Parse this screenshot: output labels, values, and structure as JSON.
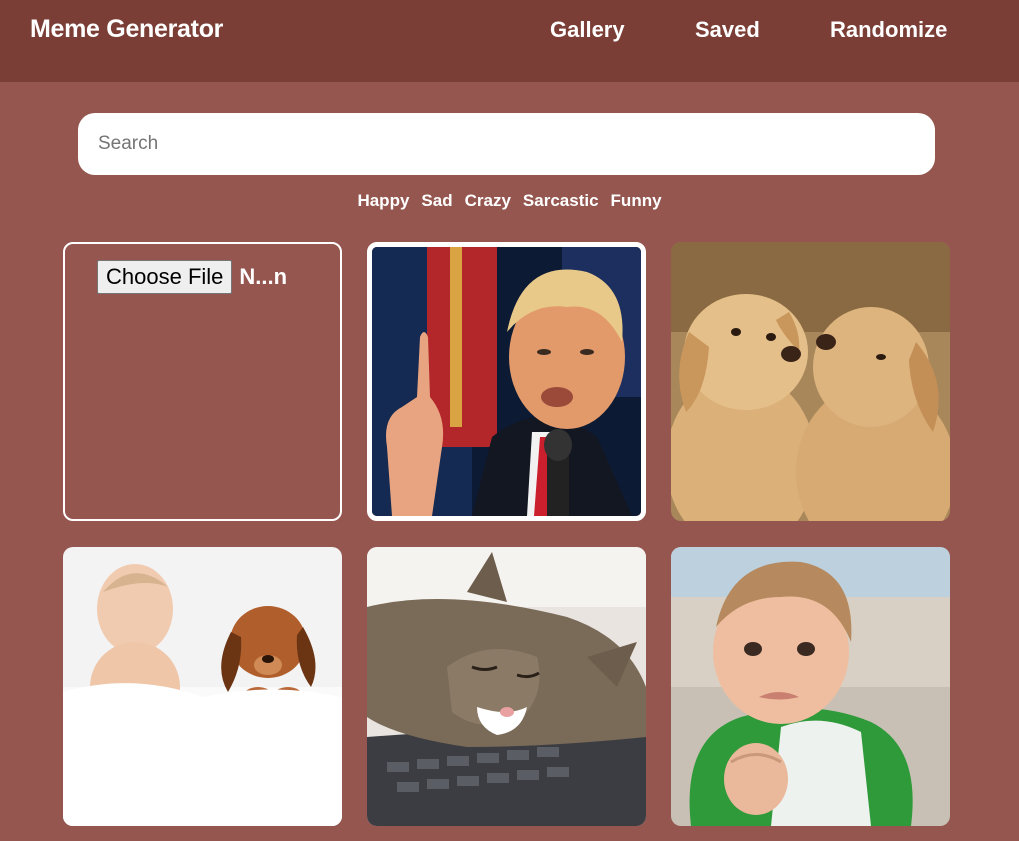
{
  "header": {
    "brand": "Meme Generator",
    "nav": [
      {
        "label": "Gallery"
      },
      {
        "label": "Saved"
      },
      {
        "label": "Randomize"
      }
    ]
  },
  "search": {
    "placeholder": "Search",
    "value": ""
  },
  "tags": [
    "Happy",
    "Sad",
    "Crazy",
    "Sarcastic",
    "Funny"
  ],
  "upload": {
    "button_label": "Choose File",
    "file_name": "N...n"
  },
  "gallery": [
    {
      "name": "trump-pointing-meme",
      "selected": true
    },
    {
      "name": "two-puppies-meme",
      "selected": false
    },
    {
      "name": "baby-and-puppy-sleeping-meme",
      "selected": false
    },
    {
      "name": "cat-sleeping-on-laptop-meme",
      "selected": false
    },
    {
      "name": "success-kid-meme",
      "selected": false
    }
  ],
  "colors": {
    "background": "#94564f",
    "navbar": "#7b3e36",
    "text": "#ffffff"
  }
}
